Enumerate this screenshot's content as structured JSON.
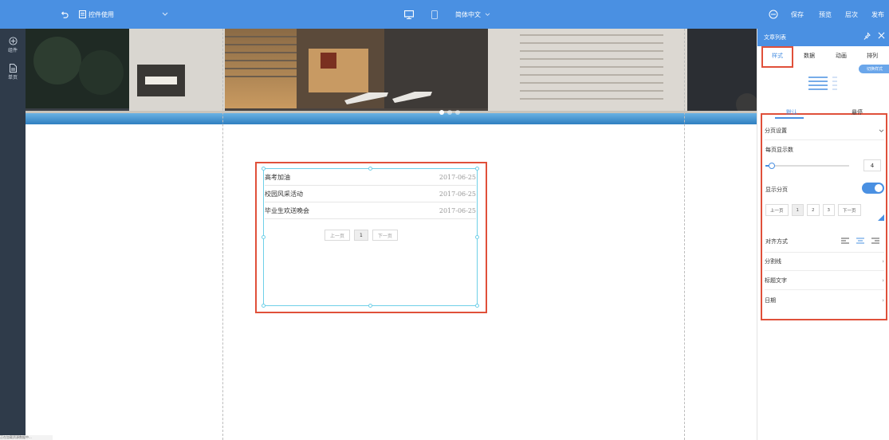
{
  "toolbar": {
    "widget_menu_label": "控件使用",
    "language_label": "简体中文",
    "save_label": "保存",
    "preview_label": "预览",
    "layers_label": "层次",
    "publish_label": "发布"
  },
  "left_rail": {
    "items": [
      {
        "label": "组件",
        "icon": "plus-circle-icon"
      },
      {
        "label": "单页",
        "icon": "page-icon"
      }
    ]
  },
  "canvas": {
    "article_list": {
      "items": [
        {
          "title": "高考加油",
          "date": "2017-06-25"
        },
        {
          "title": "校园风采活动",
          "date": "2017-06-25"
        },
        {
          "title": "毕业生欢送晚会",
          "date": "2017-06-25"
        }
      ],
      "pager": {
        "prev": "上一页",
        "current": "1",
        "next": "下一页"
      }
    },
    "slider_dots": 3,
    "slider_active_dot": 0
  },
  "right_panel": {
    "title": "文章列表",
    "tabs": [
      {
        "label": "样式",
        "active": true
      },
      {
        "label": "数据",
        "active": false
      },
      {
        "label": "动画",
        "active": false
      },
      {
        "label": "排列",
        "active": false
      }
    ],
    "switch_style_label": "切换样式",
    "sub_tabs": [
      {
        "label": "默认",
        "active": true
      },
      {
        "label": "悬停",
        "active": false
      }
    ],
    "pagination_section": "分页设置",
    "per_page_label": "每页显示数",
    "per_page_value": "4",
    "per_page_slider_fraction": 0.08,
    "show_pager_label": "显示分页",
    "show_pager_on": true,
    "pager_preview": {
      "prev": "上一页",
      "p1": "1",
      "p2": "2",
      "p3": "3",
      "next": "下一页"
    },
    "align_label": "对齐方式",
    "sections": [
      "分割线",
      "标题文字",
      "日期"
    ]
  },
  "status_bar_text": "正在加载资源数据中...",
  "colors": {
    "primary": "#4a90e2",
    "highlight_red": "#e0503a",
    "selection_cyan": "#6fd0e8",
    "rail_bg": "#2f3b4a"
  }
}
